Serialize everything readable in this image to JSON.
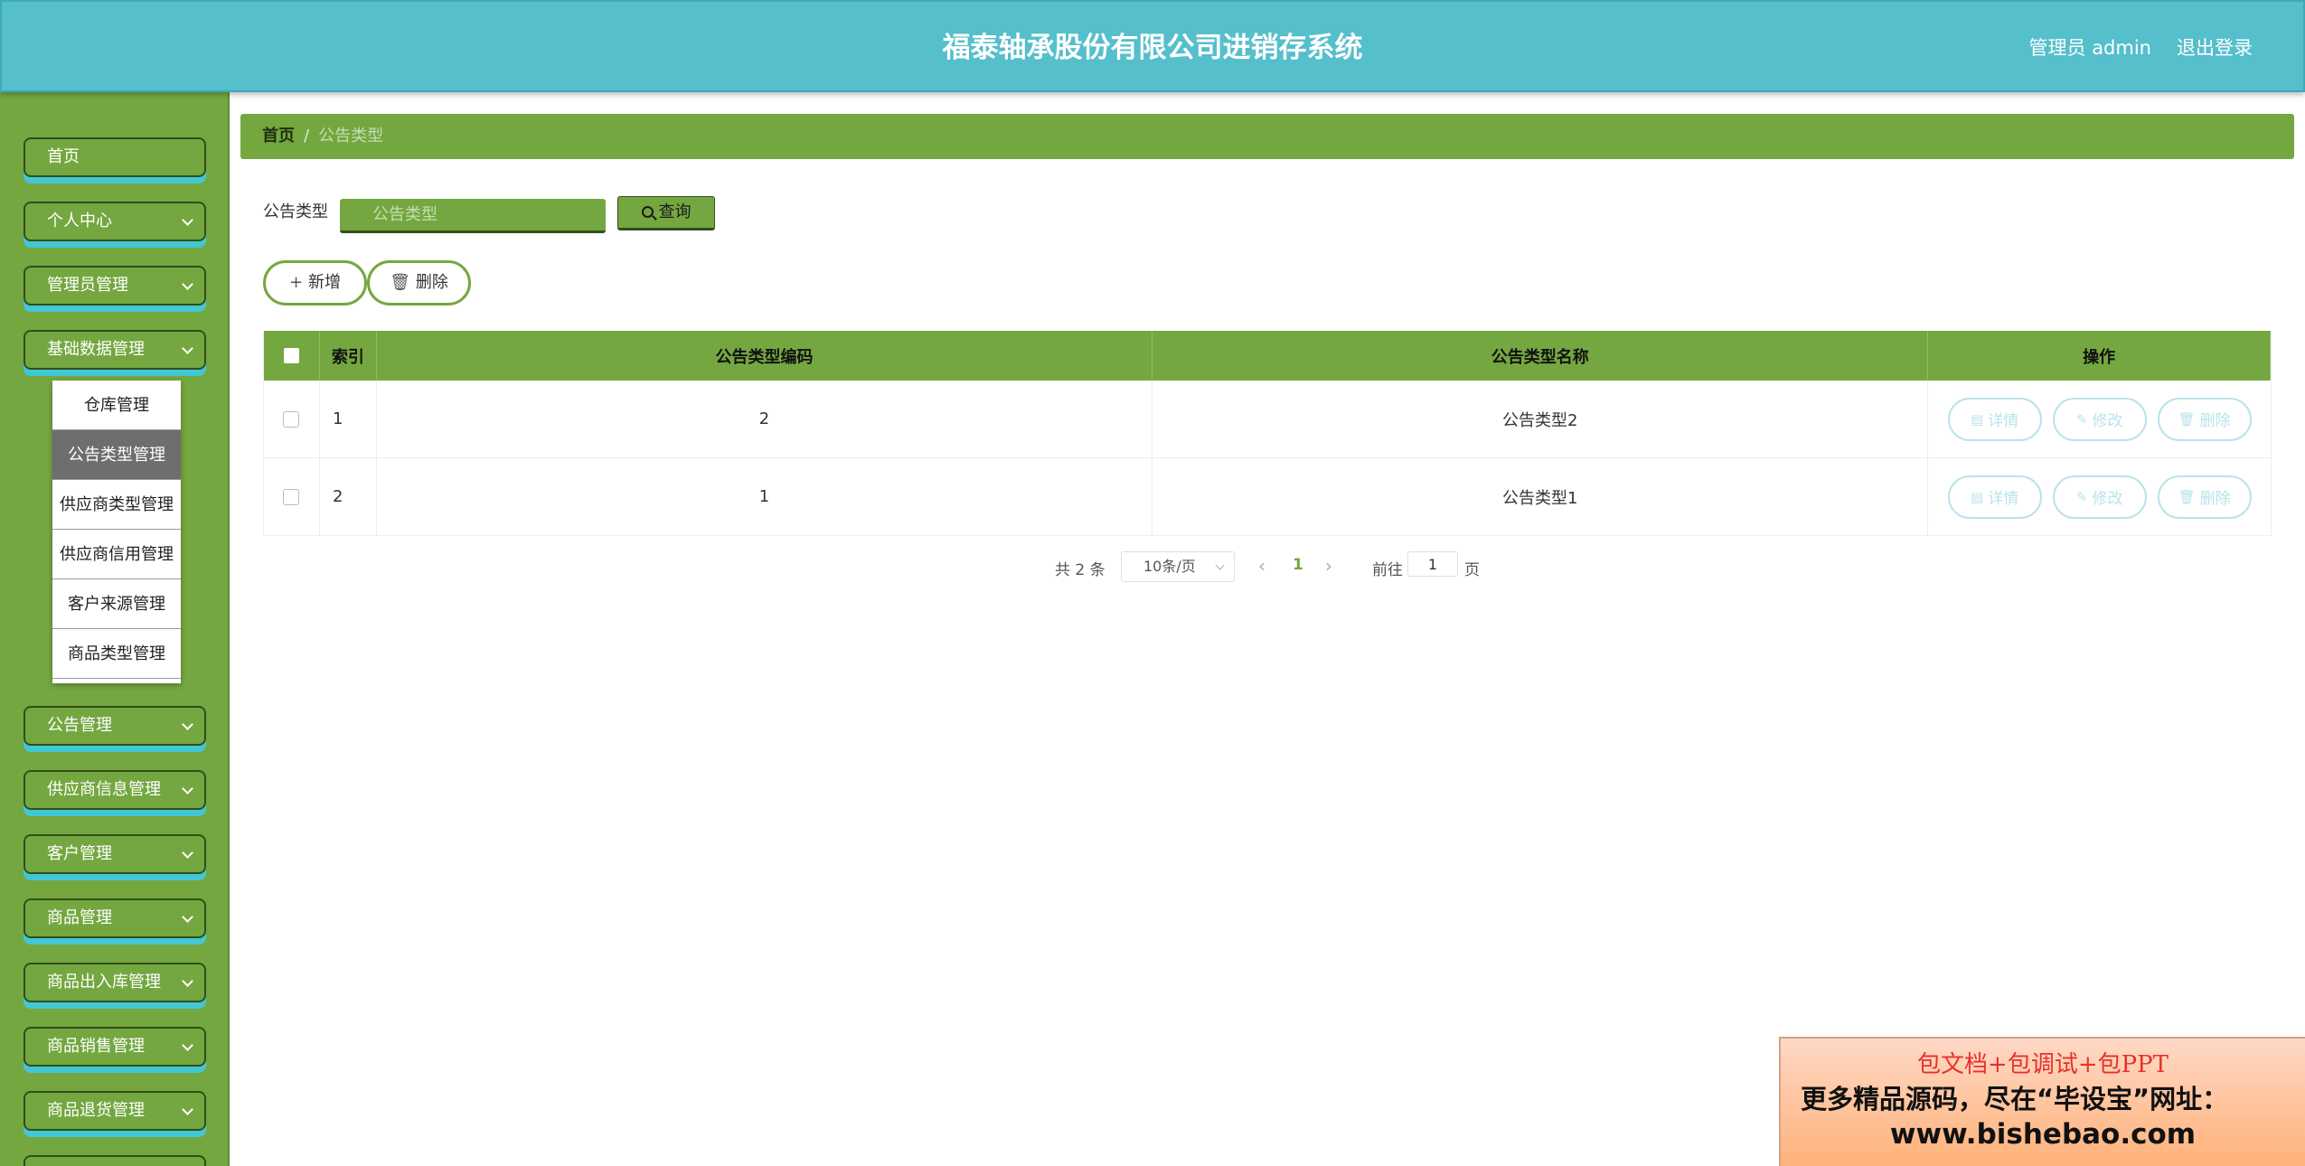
{
  "header": {
    "title": "福泰轴承股份有限公司进销存系统",
    "user": "管理员 admin",
    "logout": "退出登录"
  },
  "sidebar": {
    "items": [
      {
        "label": "首页",
        "has_arrow": false
      },
      {
        "label": "个人中心",
        "has_arrow": true
      },
      {
        "label": "管理员管理",
        "has_arrow": true
      },
      {
        "label": "基础数据管理",
        "has_arrow": true
      },
      {
        "label": "公告管理",
        "has_arrow": true
      },
      {
        "label": "供应商信息管理",
        "has_arrow": true
      },
      {
        "label": "客户管理",
        "has_arrow": true
      },
      {
        "label": "商品管理",
        "has_arrow": true
      },
      {
        "label": "商品出入库管理",
        "has_arrow": true
      },
      {
        "label": "商品销售管理",
        "has_arrow": true
      },
      {
        "label": "商品退货管理",
        "has_arrow": true
      }
    ],
    "submenu": [
      {
        "label": "仓库管理",
        "active": false
      },
      {
        "label": "公告类型管理",
        "active": true
      },
      {
        "label": "供应商类型管理",
        "active": false
      },
      {
        "label": "供应商信用管理",
        "active": false
      },
      {
        "label": "客户来源管理",
        "active": false
      },
      {
        "label": "商品类型管理",
        "active": false
      }
    ]
  },
  "breadcrumb": {
    "home": "首页",
    "separator": "/",
    "current": "公告类型"
  },
  "search": {
    "label": "公告类型",
    "placeholder": "公告类型",
    "button": "查询"
  },
  "actions": {
    "add": "新增",
    "delete": "删除"
  },
  "table": {
    "columns": [
      "索引",
      "公告类型编码",
      "公告类型名称",
      "操作"
    ],
    "rows": [
      {
        "index": "1",
        "code": "2",
        "name": "公告类型2"
      },
      {
        "index": "2",
        "code": "1",
        "name": "公告类型1"
      }
    ],
    "row_actions": {
      "detail": "详情",
      "edit": "修改",
      "delete": "删除"
    }
  },
  "pagination": {
    "total": "共 2 条",
    "page_size": "10条/页",
    "current_page": "1",
    "goto_prefix": "前往",
    "goto_value": "1",
    "goto_suffix": "页"
  },
  "ad": {
    "line1": "包文档+包调试+包PPT",
    "line2": "更多精品源码，尽在“毕设宝”网址：",
    "line3": "www.bishebao.com"
  },
  "colors": {
    "header_bg": "#55bfcc",
    "sidebar_bg": "#74a740",
    "accent_green": "#74a740",
    "nav_shadow": "#42c7d4",
    "row_button": "#b9e3ea"
  }
}
